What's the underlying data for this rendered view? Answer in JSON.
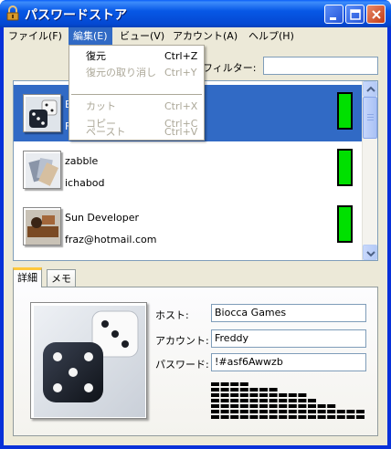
{
  "window": {
    "title": "パスワードストア",
    "icons": {
      "app": "lock-icon",
      "minimize": "minimize-icon",
      "maximize": "maximize-icon",
      "close": "close-icon"
    }
  },
  "menu": {
    "items": [
      "ファイル(F)",
      "編集(E)",
      "ビュー(V)",
      "アカウント(A)",
      "ヘルプ(H)"
    ],
    "active": "編集(E)"
  },
  "edit_menu": {
    "items": [
      {
        "label": "復元",
        "shortcut": "Ctrl+Z",
        "enabled": true
      },
      {
        "label": "復元の取り消し",
        "shortcut": "Ctrl+Y",
        "enabled": false
      },
      {
        "label": "カット",
        "shortcut": "Ctrl+X",
        "enabled": false
      },
      {
        "label": "コピー",
        "shortcut": "Ctrl+C",
        "enabled": false
      },
      {
        "label": "ペースト",
        "shortcut": "Ctrl+V",
        "enabled": false
      }
    ]
  },
  "filter": {
    "label": "フィルター:",
    "value": ""
  },
  "accounts": [
    {
      "title": "B",
      "username": "F",
      "icon": "dice-icon",
      "strength_color": "#00e000",
      "selected": true
    },
    {
      "title": "zabble",
      "username": "ichabod",
      "icon": "cards-icon",
      "strength_color": "#00e000",
      "selected": false
    },
    {
      "title": "Sun Developer",
      "username": "fraz@hotmail.com",
      "icon": "guitar-icon",
      "strength_color": "#00e000",
      "selected": false
    }
  ],
  "tabs": {
    "details": "詳細",
    "memo": "メモ",
    "active": "details"
  },
  "details": {
    "host_label": "ホスト:",
    "host": "Biocca Games",
    "account_label": "アカウント:",
    "account": "Freddy",
    "password_label": "パスワード:",
    "password": "!#asf6Awwzb",
    "photo_icon": "dice-photo"
  },
  "equalizer_levels": [
    7,
    7,
    7,
    7,
    6,
    6,
    6,
    5,
    5,
    5,
    4,
    3,
    3,
    2,
    2,
    2
  ],
  "colors": {
    "titlebar": "#0758e6",
    "selection": "#316ac5",
    "strength": "#00e000",
    "tab_accent": "#ffc83c"
  }
}
